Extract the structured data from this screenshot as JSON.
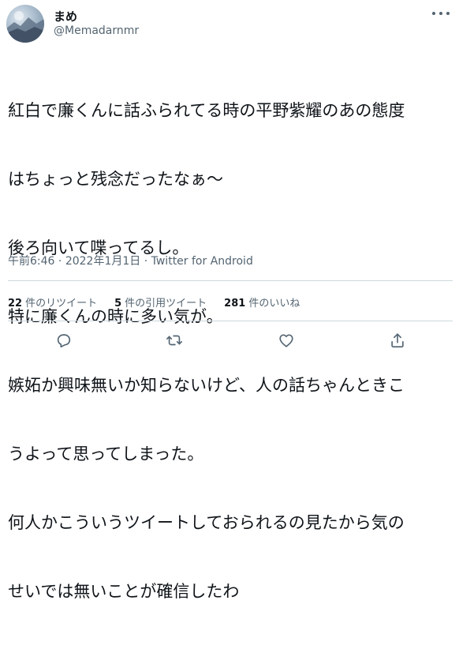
{
  "author": {
    "display_name": "まめ",
    "handle": "@Memadarnmr",
    "avatar_icon": "profile-photo-icon"
  },
  "tweet": {
    "lines": [
      "紅白で廉くんに話ふられてる時の平野紫耀のあの態度",
      "はちょっと残念だったなぁ〜",
      "後ろ向いて喋ってるし。",
      "特に廉くんの時に多い気が。",
      "嫉妬か興味無いか知らないけど、人の話ちゃんときこ",
      "うよって思ってしまった。",
      "何人かこういうツイートしておられるの見たから気の",
      "せいでは無いことが確信したわ"
    ]
  },
  "meta": {
    "time": "午前6:46",
    "separator1": " · ",
    "date": "2022年1月1日",
    "separator2": " · ",
    "source": "Twitter for Android"
  },
  "stats": {
    "retweets_count": "22",
    "retweets_label": "件のリツイート",
    "quotes_count": "5",
    "quotes_label": "件の引用ツイート",
    "likes_count": "281",
    "likes_label": "件のいいね"
  },
  "actions": {
    "reply_icon": "reply-icon",
    "retweet_icon": "retweet-icon",
    "like_icon": "heart-icon",
    "share_icon": "share-icon"
  },
  "colors": {
    "text": "#0f1419",
    "secondary": "#536471",
    "divider": "#cfd9de"
  }
}
